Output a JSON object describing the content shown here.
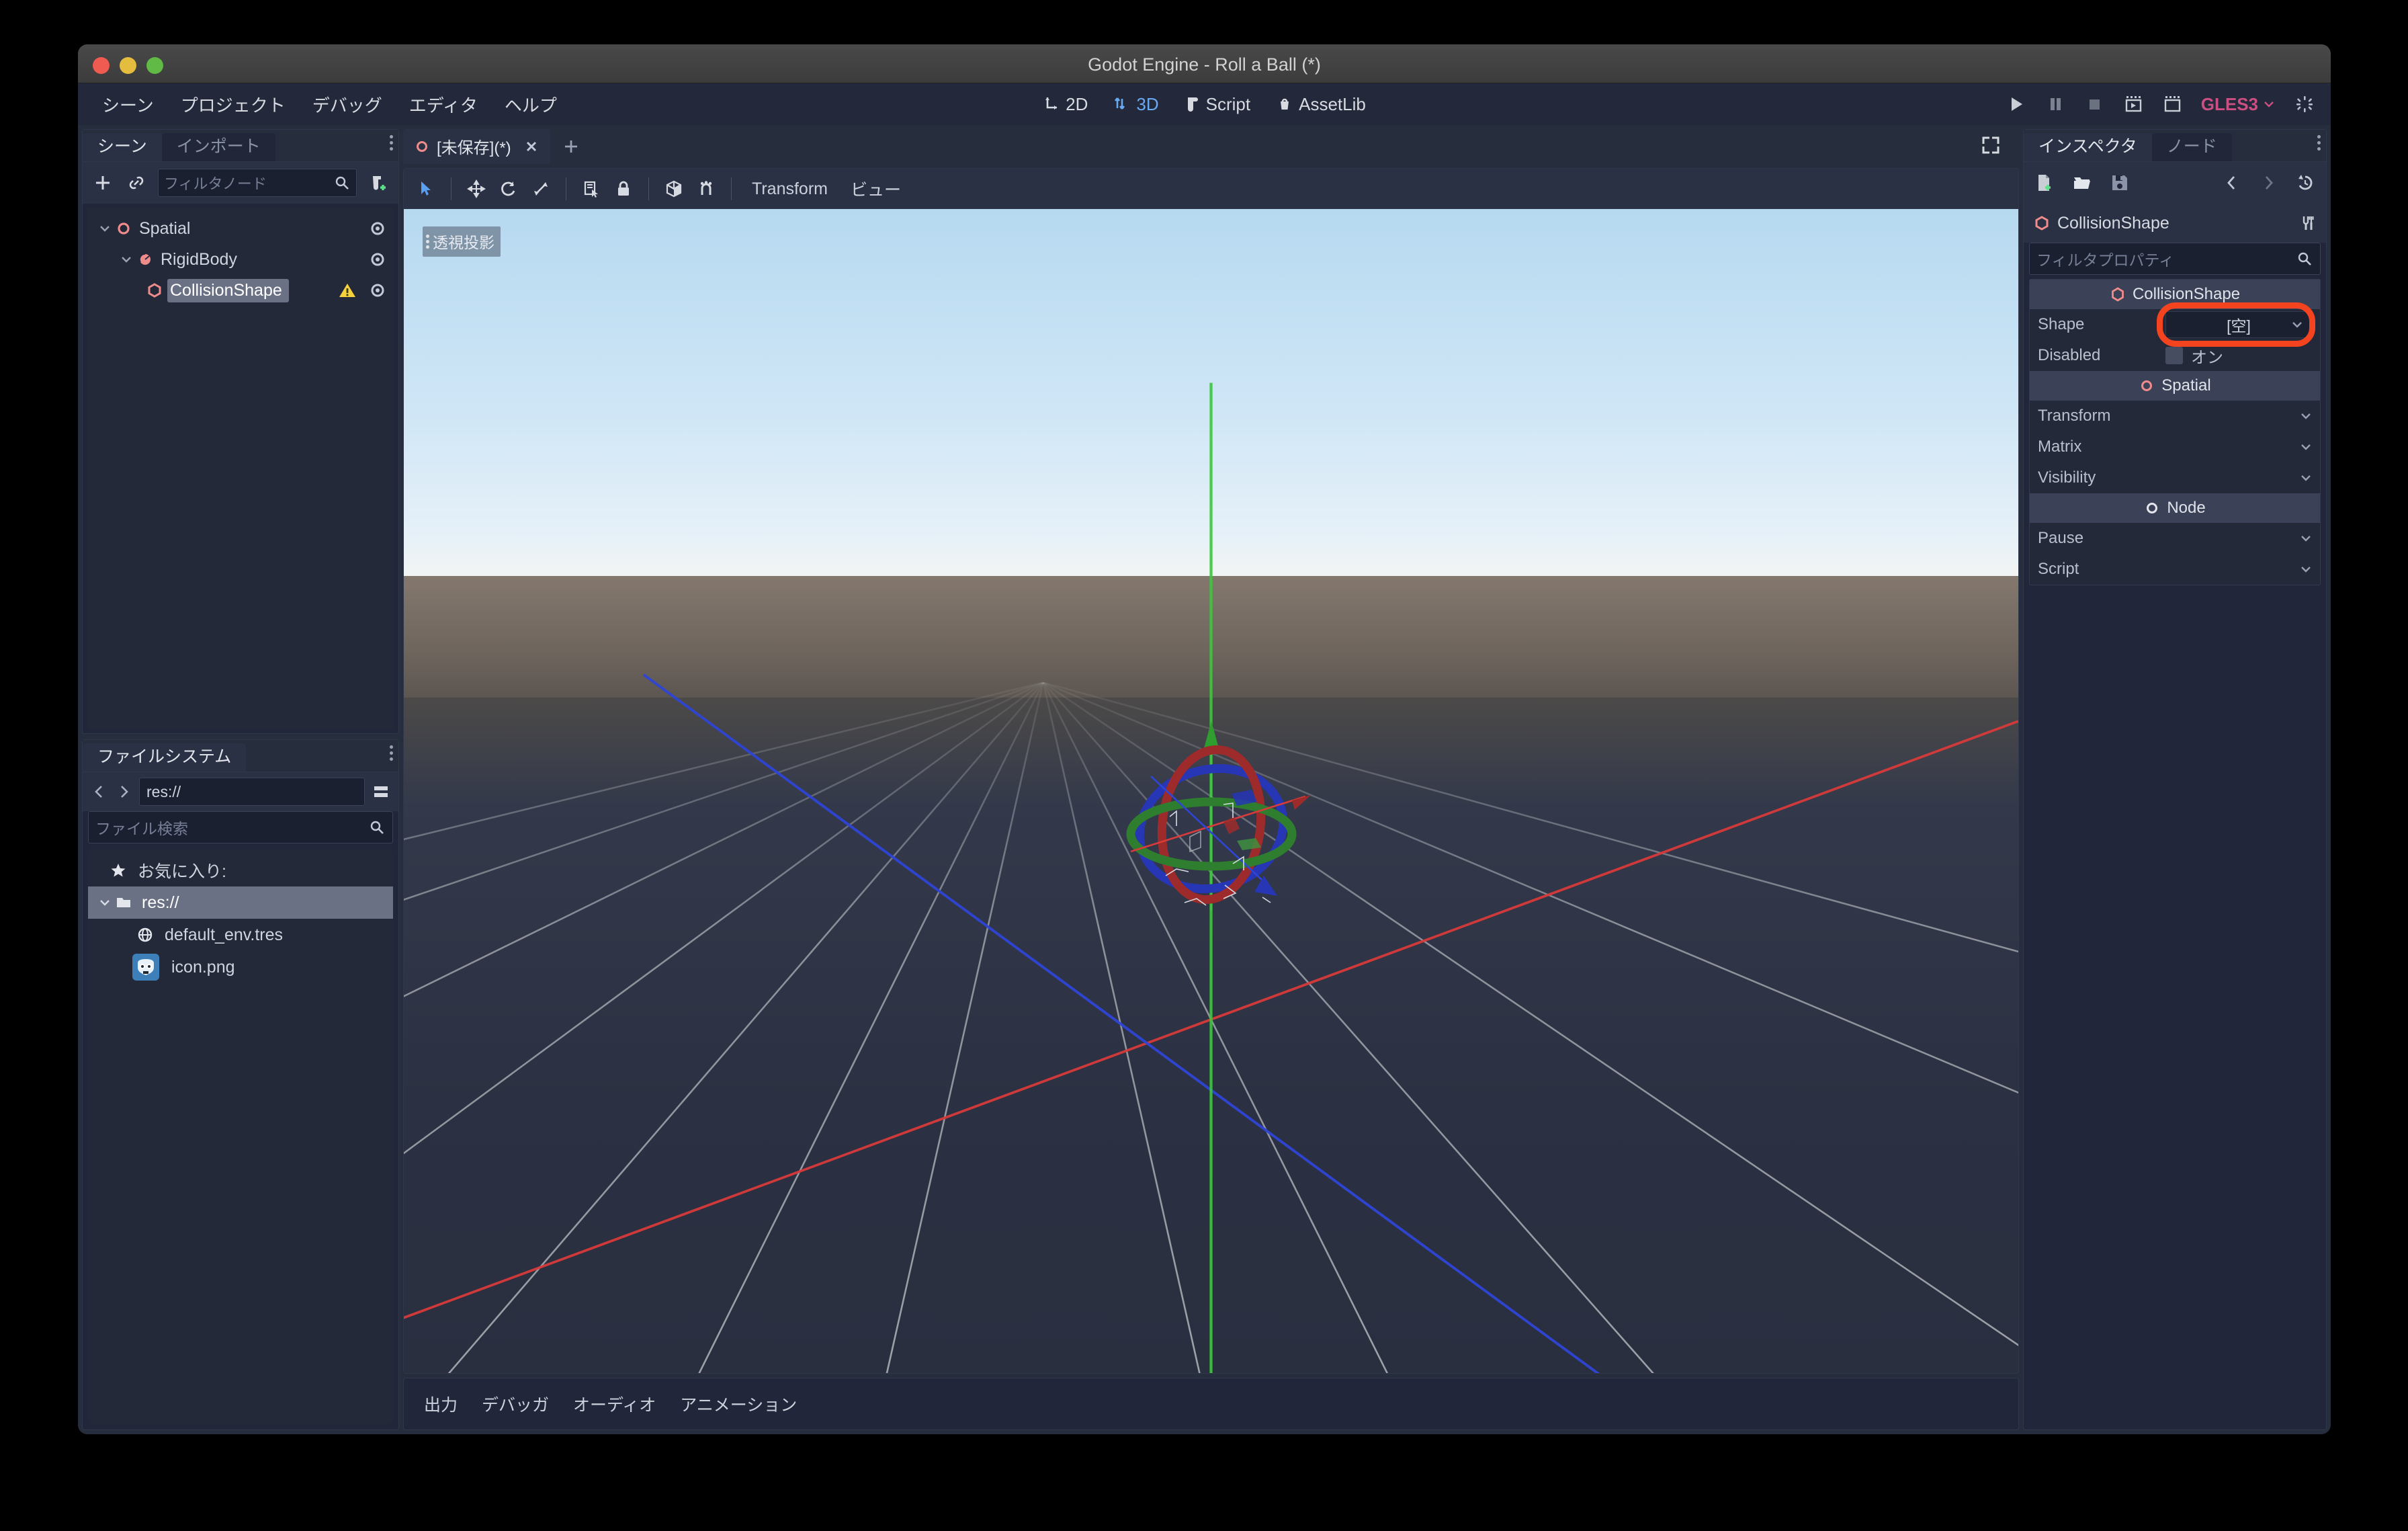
{
  "window": {
    "title": "Godot Engine - Roll a Ball (*)"
  },
  "menubar": {
    "items": [
      "シーン",
      "プロジェクト",
      "デバッグ",
      "エディタ",
      "ヘルプ"
    ]
  },
  "main_tabs": [
    {
      "label": "2D",
      "icon": "2d-icon",
      "active": false
    },
    {
      "label": "3D",
      "icon": "3d-icon",
      "active": true
    },
    {
      "label": "Script",
      "icon": "script-icon",
      "active": false
    },
    {
      "label": "AssetLib",
      "icon": "assetlib-icon",
      "active": false
    }
  ],
  "run_controls": {
    "play": "play-icon",
    "pause": "pause-icon",
    "stop": "stop-icon",
    "play_scene": "play-scene-icon",
    "play_custom": "play-custom-scene-icon",
    "renderer": "GLES3",
    "busy": "busy-spinner-icon"
  },
  "scene_dock": {
    "tabs": [
      {
        "label": "シーン",
        "active": true
      },
      {
        "label": "インポート",
        "active": false
      }
    ],
    "toolbar": {
      "add_node": "plus-icon",
      "instance_scene": "link-icon",
      "filter_placeholder": "フィルタノード",
      "search_icon": "search-icon",
      "create_script": "attach-script-icon"
    },
    "tree": [
      {
        "label": "Spatial",
        "depth": 0,
        "icon": "spatial-icon",
        "selected": false,
        "warning": false,
        "expanded": true
      },
      {
        "label": "RigidBody",
        "depth": 1,
        "icon": "rigidbody-icon",
        "selected": false,
        "warning": false,
        "expanded": true
      },
      {
        "label": "CollisionShape",
        "depth": 2,
        "icon": "collisionshape-icon",
        "selected": true,
        "warning": true,
        "expanded": false
      }
    ]
  },
  "filesystem_dock": {
    "tab": "ファイルシステム",
    "nav": {
      "back": "chevron-left-icon",
      "forward": "chevron-right-icon",
      "path": "res://",
      "toggle_split": "toggle-split-mode-icon"
    },
    "search_placeholder": "ファイル検索",
    "search_icon": "search-icon",
    "tree": [
      {
        "label": "お気に入り:",
        "depth": 0,
        "icon": "star-icon",
        "selected": false
      },
      {
        "label": "res://",
        "depth": 0,
        "icon": "folder-icon",
        "selected": true
      },
      {
        "label": "default_env.tres",
        "depth": 1,
        "icon": "environment-icon",
        "selected": false
      },
      {
        "label": "icon.png",
        "depth": 1,
        "icon": "godot-logo-icon",
        "selected": false
      }
    ]
  },
  "scene_tabs": {
    "tabs": [
      {
        "label": "[未保存](*)",
        "icon": "spatial-icon",
        "active": true
      }
    ],
    "add_tab": "plus-icon",
    "fullscreen": "distraction-free-icon"
  },
  "viewport_toolbar": {
    "buttons": [
      "select-mode-icon",
      "move-mode-icon",
      "rotate-mode-icon",
      "scale-mode-icon",
      "list-select-icon",
      "lock-icon",
      "local-space-icon",
      "snap-icon"
    ],
    "menus": [
      "Transform",
      "ビュー"
    ]
  },
  "viewport": {
    "perspective_label": "透視投影",
    "gizmo": "rotate-gizmo-three-rings",
    "colors": {
      "x_axis": "#d93a3a",
      "y_axis": "#3dc73d",
      "z_axis": "#2f45d6",
      "sky_top": "#b6d9f0",
      "ground": "#6e655d",
      "floor": "#2b3142"
    }
  },
  "bottom_dock": {
    "tabs": [
      "出力",
      "デバッガ",
      "オーディオ",
      "アニメーション"
    ]
  },
  "inspector": {
    "tabs": [
      {
        "label": "インスペクタ",
        "active": true
      },
      {
        "label": "ノード",
        "active": false
      }
    ],
    "toolbar": {
      "new_resource": "new-resource-icon",
      "load": "open-folder-icon",
      "save": "save-icon",
      "back": "chevron-left-icon",
      "forward": "chevron-right-icon",
      "history": "history-icon"
    },
    "object_name": "CollisionShape",
    "object_icon": "collisionshape-icon",
    "tools_icon": "object-tools-icon",
    "filter_placeholder": "フィルタプロパティ",
    "search_icon": "search-icon",
    "sections": [
      {
        "type": "category",
        "label": "CollisionShape",
        "icon": "collisionshape-icon",
        "rows": [
          {
            "name": "Shape",
            "kind": "resource",
            "value": "[空]",
            "highlighted": true
          },
          {
            "name": "Disabled",
            "kind": "checkbox",
            "value": "オン",
            "checked": false
          }
        ]
      },
      {
        "type": "category",
        "label": "Spatial",
        "icon": "spatial-icon",
        "rows": [
          {
            "name": "Transform",
            "kind": "group"
          },
          {
            "name": "Matrix",
            "kind": "group"
          },
          {
            "name": "Visibility",
            "kind": "group"
          }
        ]
      },
      {
        "type": "category",
        "label": "Node",
        "icon": "node-icon",
        "rows": [
          {
            "name": "Pause",
            "kind": "group"
          },
          {
            "name": "Script",
            "kind": "group"
          }
        ]
      }
    ]
  }
}
